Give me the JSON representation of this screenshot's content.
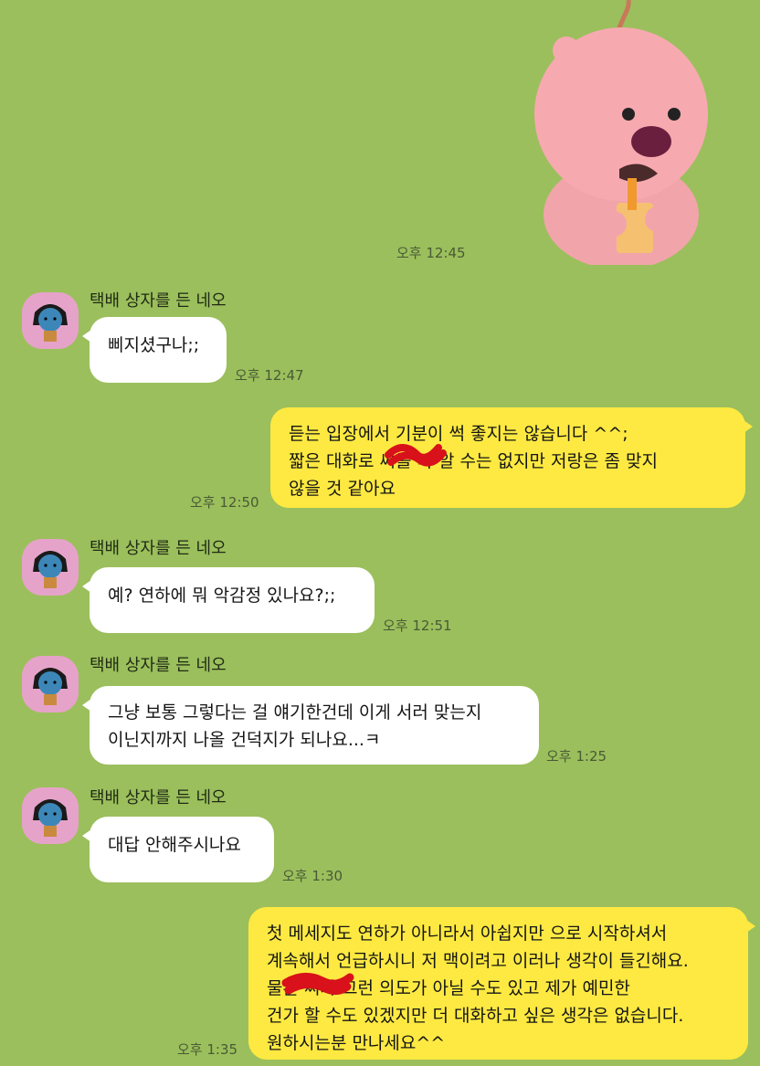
{
  "colors": {
    "background": "#9bbf5c",
    "incoming_bubble": "#ffffff",
    "outgoing_bubble": "#fde941",
    "avatar_bg": "#e6a3c9",
    "redaction": "#d8111a"
  },
  "sticker": {
    "time": "오후 12:45",
    "icon": "loopy-beaver-sticker"
  },
  "messages": [
    {
      "sender": "택배 상자를 든 네오",
      "text": "삐지셨구나;;",
      "time": "오후 12:47"
    },
    {
      "lines": [
        "듣는 입장에서 기분이 썩 좋지는 않습니다 ^^;",
        "짧은 대화로 씨를 다 알 수는 없지만 저랑은 좀 맞지",
        "않을 것 같아요"
      ],
      "time": "오후 12:50"
    },
    {
      "sender": "택배 상자를 든 네오",
      "text": "예? 연하에 뭐 악감정 있나요?;;",
      "time": "오후 12:51"
    },
    {
      "sender": "택배 상자를 든 네오",
      "lines": [
        "그냥 보통 그렇다는 걸 얘기한건데 이게 서러 맞는지",
        "이닌지까지 나올 건덕지가 되나요...ㅋ"
      ],
      "time": "오후 1:25"
    },
    {
      "sender": "택배 상자를 든 네오",
      "text": "대답 안해주시나요",
      "time": "오후 1:30"
    },
    {
      "lines": [
        "첫 메세지도 연하가 아니라서 아쉽지만 으로 시작하셔서",
        "계속해서 언급하시니 저 맥이려고 이러나 생각이 들긴해요.",
        "물론 씨가 그런 의도가 아닐 수도 있고 제가 예민한",
        "건가 할 수도 있겠지만 더 대화하고 싶은 생각은 없습니다.",
        "원하시는분 만나세요^^"
      ],
      "time": "오후 1:35"
    }
  ]
}
